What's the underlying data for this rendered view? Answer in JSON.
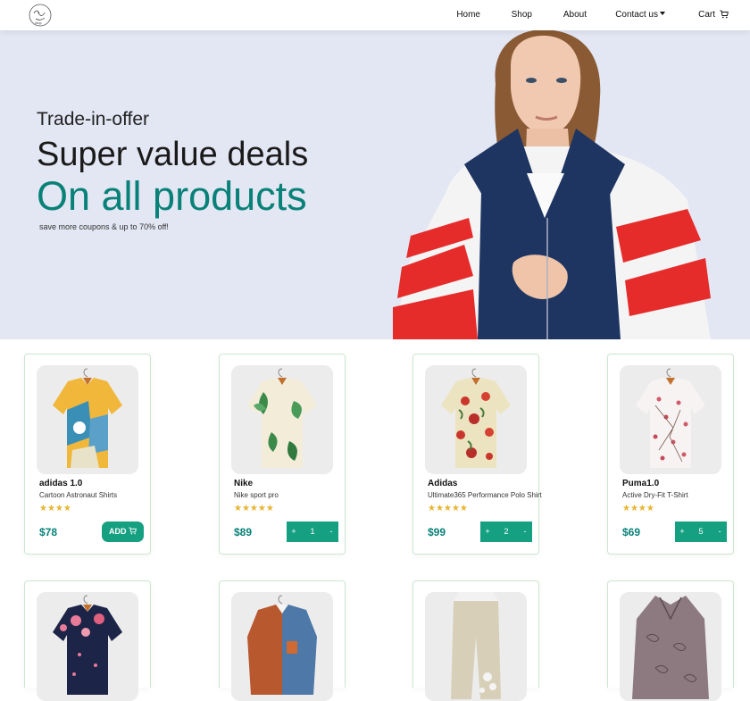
{
  "nav": {
    "logo_alt": "shop logo",
    "links": [
      {
        "label": "Home"
      },
      {
        "label": "Shop"
      },
      {
        "label": "About"
      },
      {
        "label": "Contact us"
      },
      {
        "label": "Cart"
      }
    ]
  },
  "hero": {
    "kicker": "Trade-in-offer",
    "title": "Super value deals",
    "subtitle": "On all products",
    "note": "save more coupons & up to 70% off!"
  },
  "products": [
    {
      "brand": "adidas 1.0",
      "name": "Cartoon Astronaut Shirts",
      "stars": 4,
      "price": "$78",
      "action": "add",
      "add_label": "ADD"
    },
    {
      "brand": "Nike",
      "name": "Nike sport pro",
      "stars": 5,
      "price": "$89",
      "action": "qty",
      "qty": "1"
    },
    {
      "brand": "Adidas",
      "name": "Ultimate365 Performance Polo Shirt",
      "stars": 5,
      "price": "$99",
      "action": "qty",
      "qty": "2"
    },
    {
      "brand": "Puma1.0",
      "name": "Active Dry-Fit T-Shirt",
      "stars": 4,
      "price": "$69",
      "action": "qty",
      "qty": "5"
    }
  ],
  "qty_controls": {
    "plus": "+",
    "minus": "-"
  },
  "colors": {
    "accent": "#088178",
    "button": "#15a081",
    "hero_bg": "#e3e6f3",
    "card_border": "#cce7d0",
    "star": "#e8b42d"
  }
}
